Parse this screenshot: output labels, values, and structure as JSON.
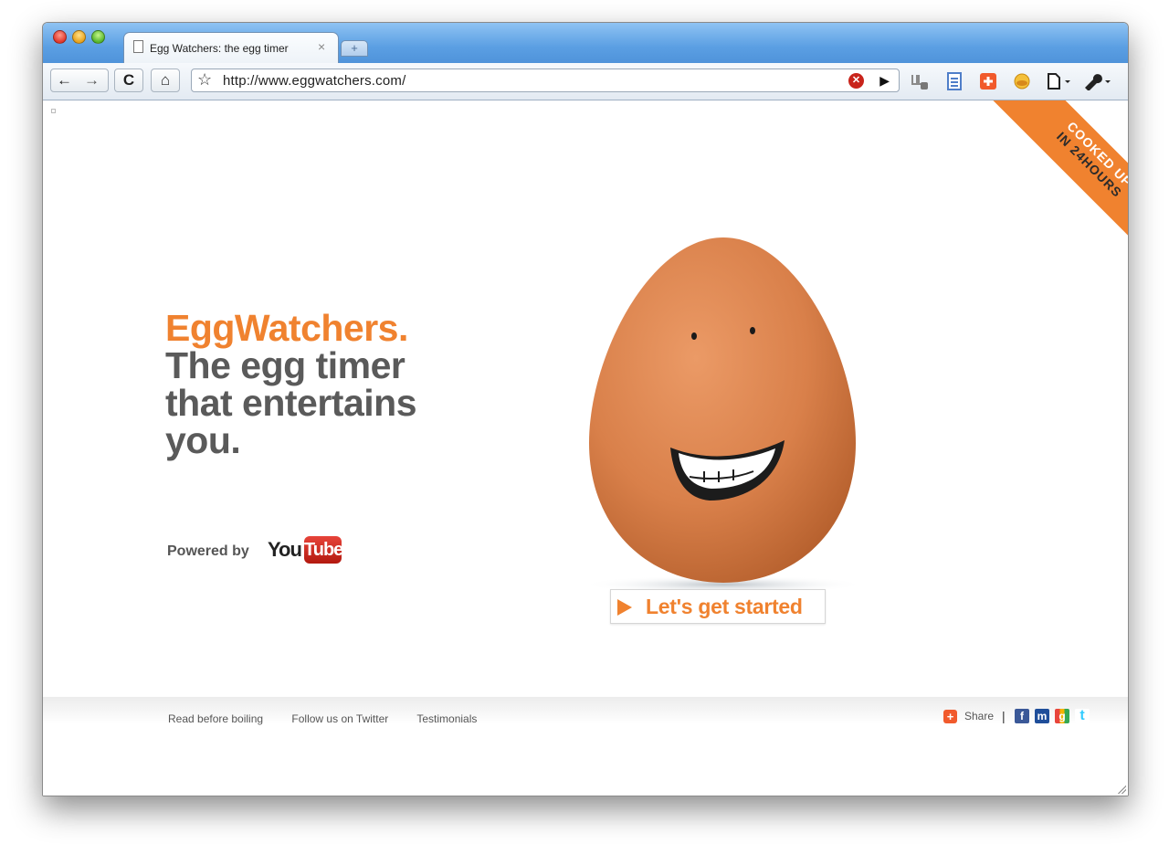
{
  "browser": {
    "tab_title": "Egg Watchers: the egg timer",
    "tab_close": "×",
    "new_tab": "+",
    "back": "←",
    "forward": "→",
    "reload": "C",
    "home": "⌂",
    "bookmark_star": "☆",
    "url": "http://www.eggwatchers.com/",
    "extension_stop": "✕",
    "extension_play": "▶"
  },
  "page": {
    "ribbon_line1": "COOKED UP",
    "ribbon_line2": "IN 24HOURS",
    "brand": "EggWatchers.",
    "tagline": "The egg timer that entertains you.",
    "powered_by": "Powered by",
    "youtube_you": "You",
    "youtube_tube": "Tube",
    "cta_label": "Let's get started"
  },
  "footer": {
    "links": [
      "Read before boiling",
      "Follow us on Twitter",
      "Testimonials"
    ],
    "share_label": "Share",
    "separator": "|"
  },
  "colors": {
    "accent": "#f0822f",
    "headline_gray": "#5a5a5a",
    "egg": "#d9804a",
    "titlebar": "#5b9fe3"
  },
  "icons": {
    "social": [
      "facebook-icon",
      "myspace-icon",
      "google-icon",
      "twitter-icon"
    ]
  }
}
